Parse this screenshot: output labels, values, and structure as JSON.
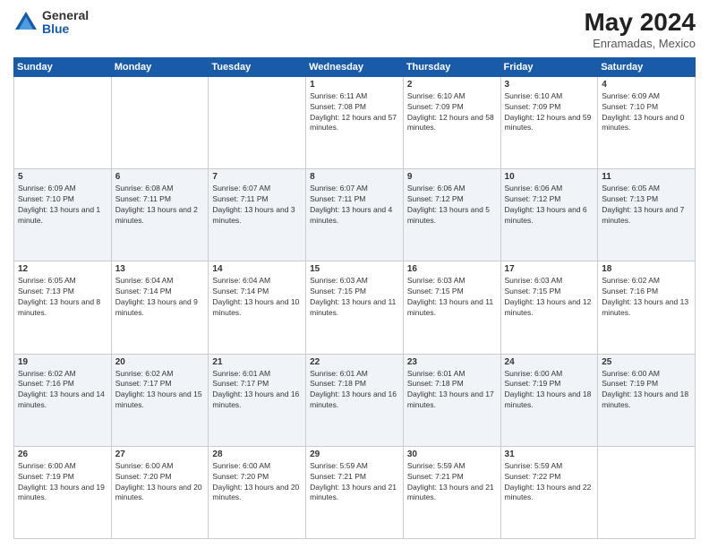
{
  "logo": {
    "general": "General",
    "blue": "Blue"
  },
  "title": "May 2024",
  "location": "Enramadas, Mexico",
  "days_of_week": [
    "Sunday",
    "Monday",
    "Tuesday",
    "Wednesday",
    "Thursday",
    "Friday",
    "Saturday"
  ],
  "weeks": [
    [
      {
        "day": "",
        "info": ""
      },
      {
        "day": "",
        "info": ""
      },
      {
        "day": "",
        "info": ""
      },
      {
        "day": "1",
        "info": "Sunrise: 6:11 AM\nSunset: 7:08 PM\nDaylight: 12 hours and 57 minutes."
      },
      {
        "day": "2",
        "info": "Sunrise: 6:10 AM\nSunset: 7:09 PM\nDaylight: 12 hours and 58 minutes."
      },
      {
        "day": "3",
        "info": "Sunrise: 6:10 AM\nSunset: 7:09 PM\nDaylight: 12 hours and 59 minutes."
      },
      {
        "day": "4",
        "info": "Sunrise: 6:09 AM\nSunset: 7:10 PM\nDaylight: 13 hours and 0 minutes."
      }
    ],
    [
      {
        "day": "5",
        "info": "Sunrise: 6:09 AM\nSunset: 7:10 PM\nDaylight: 13 hours and 1 minute."
      },
      {
        "day": "6",
        "info": "Sunrise: 6:08 AM\nSunset: 7:11 PM\nDaylight: 13 hours and 2 minutes."
      },
      {
        "day": "7",
        "info": "Sunrise: 6:07 AM\nSunset: 7:11 PM\nDaylight: 13 hours and 3 minutes."
      },
      {
        "day": "8",
        "info": "Sunrise: 6:07 AM\nSunset: 7:11 PM\nDaylight: 13 hours and 4 minutes."
      },
      {
        "day": "9",
        "info": "Sunrise: 6:06 AM\nSunset: 7:12 PM\nDaylight: 13 hours and 5 minutes."
      },
      {
        "day": "10",
        "info": "Sunrise: 6:06 AM\nSunset: 7:12 PM\nDaylight: 13 hours and 6 minutes."
      },
      {
        "day": "11",
        "info": "Sunrise: 6:05 AM\nSunset: 7:13 PM\nDaylight: 13 hours and 7 minutes."
      }
    ],
    [
      {
        "day": "12",
        "info": "Sunrise: 6:05 AM\nSunset: 7:13 PM\nDaylight: 13 hours and 8 minutes."
      },
      {
        "day": "13",
        "info": "Sunrise: 6:04 AM\nSunset: 7:14 PM\nDaylight: 13 hours and 9 minutes."
      },
      {
        "day": "14",
        "info": "Sunrise: 6:04 AM\nSunset: 7:14 PM\nDaylight: 13 hours and 10 minutes."
      },
      {
        "day": "15",
        "info": "Sunrise: 6:03 AM\nSunset: 7:15 PM\nDaylight: 13 hours and 11 minutes."
      },
      {
        "day": "16",
        "info": "Sunrise: 6:03 AM\nSunset: 7:15 PM\nDaylight: 13 hours and 11 minutes."
      },
      {
        "day": "17",
        "info": "Sunrise: 6:03 AM\nSunset: 7:15 PM\nDaylight: 13 hours and 12 minutes."
      },
      {
        "day": "18",
        "info": "Sunrise: 6:02 AM\nSunset: 7:16 PM\nDaylight: 13 hours and 13 minutes."
      }
    ],
    [
      {
        "day": "19",
        "info": "Sunrise: 6:02 AM\nSunset: 7:16 PM\nDaylight: 13 hours and 14 minutes."
      },
      {
        "day": "20",
        "info": "Sunrise: 6:02 AM\nSunset: 7:17 PM\nDaylight: 13 hours and 15 minutes."
      },
      {
        "day": "21",
        "info": "Sunrise: 6:01 AM\nSunset: 7:17 PM\nDaylight: 13 hours and 16 minutes."
      },
      {
        "day": "22",
        "info": "Sunrise: 6:01 AM\nSunset: 7:18 PM\nDaylight: 13 hours and 16 minutes."
      },
      {
        "day": "23",
        "info": "Sunrise: 6:01 AM\nSunset: 7:18 PM\nDaylight: 13 hours and 17 minutes."
      },
      {
        "day": "24",
        "info": "Sunrise: 6:00 AM\nSunset: 7:19 PM\nDaylight: 13 hours and 18 minutes."
      },
      {
        "day": "25",
        "info": "Sunrise: 6:00 AM\nSunset: 7:19 PM\nDaylight: 13 hours and 18 minutes."
      }
    ],
    [
      {
        "day": "26",
        "info": "Sunrise: 6:00 AM\nSunset: 7:19 PM\nDaylight: 13 hours and 19 minutes."
      },
      {
        "day": "27",
        "info": "Sunrise: 6:00 AM\nSunset: 7:20 PM\nDaylight: 13 hours and 20 minutes."
      },
      {
        "day": "28",
        "info": "Sunrise: 6:00 AM\nSunset: 7:20 PM\nDaylight: 13 hours and 20 minutes."
      },
      {
        "day": "29",
        "info": "Sunrise: 5:59 AM\nSunset: 7:21 PM\nDaylight: 13 hours and 21 minutes."
      },
      {
        "day": "30",
        "info": "Sunrise: 5:59 AM\nSunset: 7:21 PM\nDaylight: 13 hours and 21 minutes."
      },
      {
        "day": "31",
        "info": "Sunrise: 5:59 AM\nSunset: 7:22 PM\nDaylight: 13 hours and 22 minutes."
      },
      {
        "day": "",
        "info": ""
      }
    ]
  ]
}
